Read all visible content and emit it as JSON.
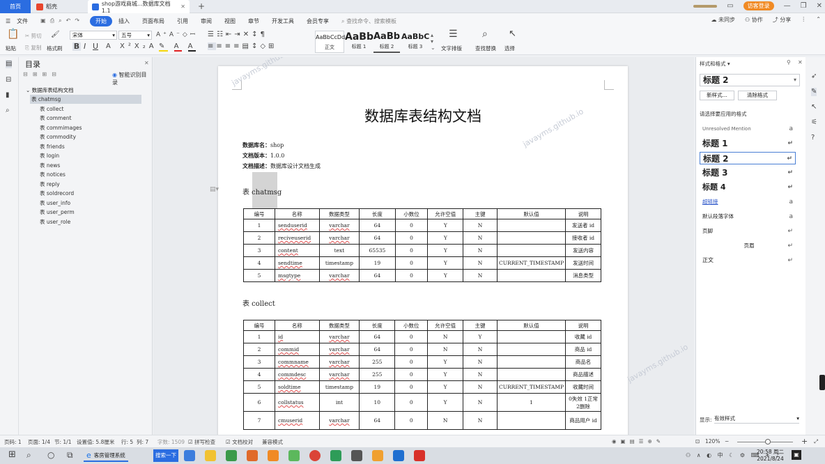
{
  "tabs": {
    "home": "首页",
    "draft": "稻壳",
    "document": "shop游戏商城...数据库文档1.1",
    "login_button": "访客登录"
  },
  "menu": {
    "file": "文件",
    "items": [
      "开始",
      "插入",
      "页面布局",
      "引用",
      "审阅",
      "视图",
      "章节",
      "开发工具",
      "会员专享"
    ],
    "search_placeholder": "查找命令、搜索模板",
    "unsynced": "未同步",
    "collab": "协作",
    "share": "分享"
  },
  "ribbon": {
    "paste": "粘贴",
    "cut": "剪切",
    "copy": "复制",
    "format_painter": "格式刷",
    "font_name": "宋体",
    "font_size": "五号",
    "styles": [
      {
        "preview": "AaBbCcDd",
        "label": "正文"
      },
      {
        "preview": "AaBb",
        "label": "标题 1"
      },
      {
        "preview": "AaBb(",
        "label": "标题 2"
      },
      {
        "preview": "AaBbC(",
        "label": "标题 3"
      }
    ],
    "text_layout": "文字排版",
    "find_replace": "查找替换",
    "select": "选择"
  },
  "outline": {
    "title": "目录",
    "smart": "智能识别目录",
    "root": "数据库表结构文档",
    "items": [
      "表 chatmsg",
      "表 collect",
      "表 comment",
      "表 commimages",
      "表 commodity",
      "表 friends",
      "表 login",
      "表 news",
      "表 notices",
      "表 reply",
      "表 soldrecord",
      "表 user_info",
      "表 user_perm",
      "表 user_role"
    ]
  },
  "document": {
    "title": "数据库表结构文档",
    "db_label": "数据库名：",
    "db_value": "shop",
    "ver_label": "文档版本：",
    "ver_value": "1.0.0",
    "desc_label": "文档描述：",
    "desc_value": "数据库设计文档生成",
    "table1_title": "表 chatmsg",
    "table2_title": "表 collect",
    "columns": [
      "编号",
      "名称",
      "数据类型",
      "长度",
      "小数位",
      "允许空值",
      "主键",
      "默认值",
      "说明"
    ],
    "table1_rows": [
      [
        "1",
        "senduserid",
        "varchar",
        "64",
        "0",
        "Y",
        "N",
        "",
        "发送者 id"
      ],
      [
        "2",
        "reciveuserid",
        "varchar",
        "64",
        "0",
        "Y",
        "N",
        "",
        "接收者 id"
      ],
      [
        "3",
        "content",
        "text",
        "65535",
        "0",
        "Y",
        "N",
        "",
        "发送内容"
      ],
      [
        "4",
        "sendtime",
        "timestamp",
        "19",
        "0",
        "Y",
        "N",
        "CURRENT_TIMESTAMP",
        "发送时间"
      ],
      [
        "5",
        "msgtype",
        "varchar",
        "64",
        "0",
        "Y",
        "N",
        "",
        "消息类型"
      ]
    ],
    "table2_rows": [
      [
        "1",
        "id",
        "varchar",
        "64",
        "0",
        "N",
        "Y",
        "",
        "收藏 id"
      ],
      [
        "2",
        "commid",
        "varchar",
        "64",
        "0",
        "N",
        "N",
        "",
        "商品 id"
      ],
      [
        "3",
        "commname",
        "varchar",
        "255",
        "0",
        "Y",
        "N",
        "",
        "商品名"
      ],
      [
        "4",
        "commdesc",
        "varchar",
        "255",
        "0",
        "Y",
        "N",
        "",
        "商品描述"
      ],
      [
        "5",
        "soldtime",
        "timestamp",
        "19",
        "0",
        "Y",
        "N",
        "CURRENT_TIMESTAMP",
        "收藏时间"
      ],
      [
        "6",
        "collstatus",
        "int",
        "10",
        "0",
        "Y",
        "N",
        "1",
        "0失效 1正常 2删除"
      ],
      [
        "7",
        "cmuserid",
        "varchar",
        "64",
        "0",
        "N",
        "N",
        "",
        "商品用户 id"
      ]
    ],
    "watermark": "javayms.github.io"
  },
  "style_panel": {
    "title": "样式和格式",
    "current": "标题 2",
    "new_style": "新样式...",
    "clear_format": "清除格式",
    "hint": "请选择要应用的格式",
    "items": [
      "Unresolved Mention",
      "标题 1",
      "标题 2",
      "标题 3",
      "标题 4",
      "超链接",
      "默认段落字体",
      "页脚",
      "页眉",
      "正文"
    ],
    "show_label": "显示:",
    "show_value": "有效样式"
  },
  "status": {
    "page_num": "页码: 1",
    "pages": "页面: 1/4",
    "section": "节: 1/1",
    "setting": "设置值: 5.8厘米",
    "row": "行: 5",
    "col": "列: 7",
    "words": "字数: 1509",
    "spell": "拼写检查",
    "proof": "文档校对",
    "compat": "兼容模式",
    "zoom": "120%"
  },
  "taskbar": {
    "app": "客房管理系统",
    "search": "搜索一下",
    "time": "20:58 周二",
    "date": "2021/8/24"
  }
}
